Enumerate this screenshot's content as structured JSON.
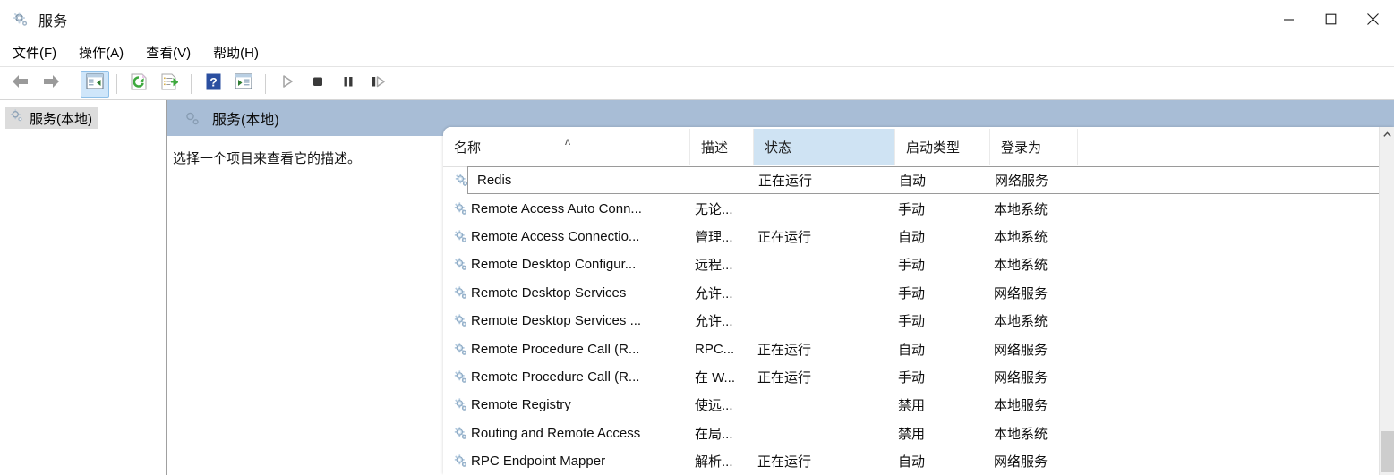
{
  "window": {
    "title": "服务",
    "icon": "services-gear-icon",
    "controls": {
      "minimize": "—",
      "maximize": "▢",
      "close": "✕"
    }
  },
  "menubar": {
    "items": [
      {
        "label": "文件(F)",
        "name": "menu-file"
      },
      {
        "label": "操作(A)",
        "name": "menu-action"
      },
      {
        "label": "查看(V)",
        "name": "menu-view"
      },
      {
        "label": "帮助(H)",
        "name": "menu-help"
      }
    ]
  },
  "toolbar": {
    "buttons": [
      {
        "icon": "back-arrow-icon",
        "name": "toolbar-back",
        "active": false
      },
      {
        "icon": "forward-arrow-icon",
        "name": "toolbar-forward",
        "active": false
      },
      {
        "icon": "show-hide-tree-icon",
        "name": "toolbar-show-hide-console-tree",
        "active": true
      },
      {
        "icon": "refresh-icon",
        "name": "toolbar-refresh",
        "active": false
      },
      {
        "icon": "export-list-icon",
        "name": "toolbar-export-list",
        "active": false
      },
      {
        "icon": "help-icon",
        "name": "toolbar-help",
        "active": false
      },
      {
        "icon": "properties-icon",
        "name": "toolbar-properties",
        "active": false
      },
      {
        "icon": "play-icon",
        "name": "toolbar-start-service",
        "active": false
      },
      {
        "icon": "stop-icon",
        "name": "toolbar-stop-service",
        "active": false
      },
      {
        "icon": "pause-icon",
        "name": "toolbar-pause-service",
        "active": false
      },
      {
        "icon": "restart-icon",
        "name": "toolbar-restart-service",
        "active": false
      }
    ]
  },
  "tree": {
    "items": [
      {
        "label": "服务(本地)",
        "icon": "services-gear-icon",
        "selected": true
      }
    ]
  },
  "console": {
    "header_title": "服务(本地)",
    "header_icon": "services-gear-icon",
    "description": "选择一个项目来查看它的描述。"
  },
  "list": {
    "columns": [
      {
        "label": "名称",
        "name": "column-name",
        "sorted": "asc",
        "highlighted": false
      },
      {
        "label": "描述",
        "name": "column-description",
        "sorted": "",
        "highlighted": false
      },
      {
        "label": "状态",
        "name": "column-status",
        "sorted": "",
        "highlighted": true
      },
      {
        "label": "启动类型",
        "name": "column-startup-type",
        "sorted": "",
        "highlighted": false
      },
      {
        "label": "登录为",
        "name": "column-log-on-as",
        "sorted": "",
        "highlighted": false
      }
    ],
    "sort_caret": "ᴧ",
    "rows": [
      {
        "name": "Redis",
        "description": "",
        "status": "正在运行",
        "startup": "自动",
        "logon": "网络服务",
        "selected": true
      },
      {
        "name": "Remote Access Auto Conn...",
        "description": "无论...",
        "status": "",
        "startup": "手动",
        "logon": "本地系统",
        "selected": false
      },
      {
        "name": "Remote Access Connectio...",
        "description": "管理...",
        "status": "正在运行",
        "startup": "自动",
        "logon": "本地系统",
        "selected": false
      },
      {
        "name": "Remote Desktop Configur...",
        "description": "远程...",
        "status": "",
        "startup": "手动",
        "logon": "本地系统",
        "selected": false
      },
      {
        "name": "Remote Desktop Services",
        "description": "允许...",
        "status": "",
        "startup": "手动",
        "logon": "网络服务",
        "selected": false
      },
      {
        "name": "Remote Desktop Services ...",
        "description": "允许...",
        "status": "",
        "startup": "手动",
        "logon": "本地系统",
        "selected": false
      },
      {
        "name": "Remote Procedure Call (R...",
        "description": "RPC...",
        "status": "正在运行",
        "startup": "自动",
        "logon": "网络服务",
        "selected": false
      },
      {
        "name": "Remote Procedure Call (R...",
        "description": "在 W...",
        "status": "正在运行",
        "startup": "手动",
        "logon": "网络服务",
        "selected": false
      },
      {
        "name": "Remote Registry",
        "description": "使远...",
        "status": "",
        "startup": "禁用",
        "logon": "本地服务",
        "selected": false
      },
      {
        "name": "Routing and Remote Access",
        "description": "在局...",
        "status": "",
        "startup": "禁用",
        "logon": "本地系统",
        "selected": false
      },
      {
        "name": "RPC Endpoint Mapper",
        "description": "解析...",
        "status": "正在运行",
        "startup": "自动",
        "logon": "网络服务",
        "selected": false
      }
    ]
  },
  "scrollbar": {
    "up_arrow": "⌃",
    "name": "vertical-scrollbar"
  },
  "colors": {
    "banner": "#a8bdd6",
    "header_highlight": "#cfe3f3",
    "tree_selection": "#dcdcdc",
    "toolbar_active": "#cfe6fa"
  }
}
